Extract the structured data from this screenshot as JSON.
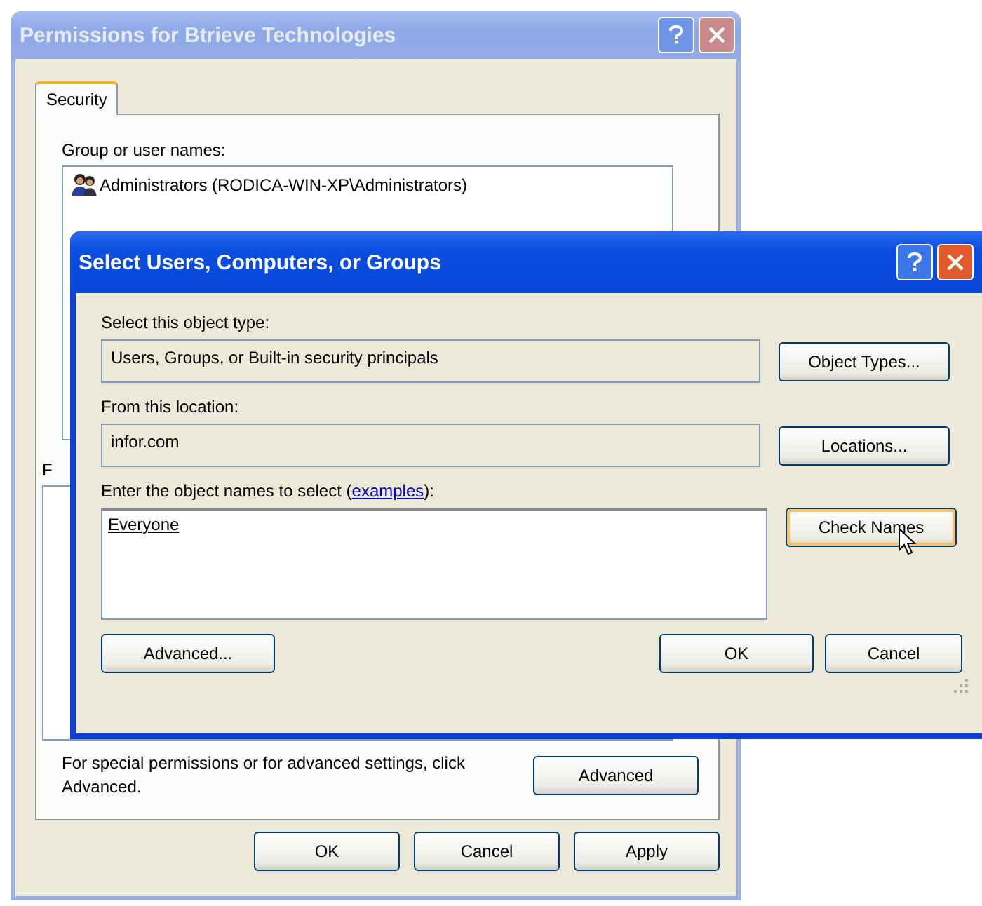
{
  "permissions_window": {
    "title": "Permissions for Btrieve Technologies",
    "tabs": [
      {
        "label": "Security",
        "selected": true
      }
    ],
    "group_label": "Group or user names:",
    "users": [
      {
        "name": "Administrators (RODICA-WIN-XP\\Administrators)"
      }
    ],
    "permissions_label": "F",
    "advanced_note": "For special permissions or for advanced settings, click Advanced.",
    "advanced_button": "Advanced",
    "buttons": [
      "OK",
      "Cancel",
      "Apply"
    ]
  },
  "select_dialog": {
    "title": "Select Users, Computers, or Groups",
    "object_type_label": "Select this object type:",
    "object_type": "Users, Groups, or Built-in security principals",
    "object_types_button": "Object Types...",
    "location_label": "From this location:",
    "location": "infor.com",
    "locations_button": "Locations...",
    "names_label": {
      "before": "Enter the object names to select (",
      "link": "examples",
      "after": "):"
    },
    "names_value": "Everyone",
    "check_names_button": {
      "label": "Check Names",
      "hovered": true
    },
    "advanced_button": "Advanced...",
    "buttons": [
      "OK",
      "Cancel"
    ]
  }
}
